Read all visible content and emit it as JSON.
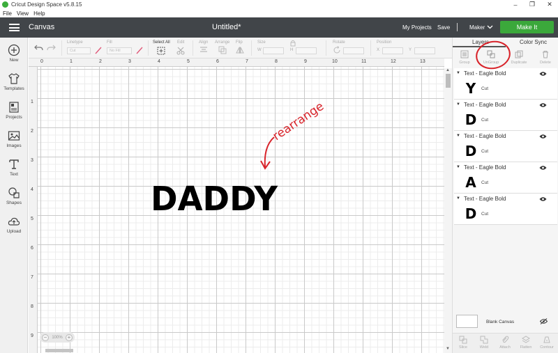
{
  "app": {
    "window_title": "Cricut Design Space  v5.8.15",
    "menu": [
      "File",
      "View",
      "Help"
    ]
  },
  "header": {
    "section": "Canvas",
    "doc_title": "Untitled*",
    "my_projects": "My Projects",
    "save": "Save",
    "separator": "|",
    "machine": "Maker",
    "make_it": "Make It"
  },
  "sidebar": {
    "items": [
      {
        "label": "New",
        "icon": "plus-circle-icon"
      },
      {
        "label": "Templates",
        "icon": "tshirt-icon"
      },
      {
        "label": "Projects",
        "icon": "projects-icon"
      },
      {
        "label": "Images",
        "icon": "image-icon"
      },
      {
        "label": "Text",
        "icon": "text-t-icon"
      },
      {
        "label": "Shapes",
        "icon": "shapes-icon"
      },
      {
        "label": "Upload",
        "icon": "cloud-upload-icon"
      }
    ]
  },
  "toolbar": {
    "linetype_label": "Linetype",
    "linetype_value": "Cut",
    "fill_label": "Fill",
    "fill_value": "No Fill",
    "select_all": "Select All",
    "edit": "Edit",
    "align": "Align",
    "arrange": "Arrange",
    "flip": "Flip",
    "size": "Size",
    "size_w": "W",
    "size_h": "H",
    "rotate": "Rotate",
    "position": "Position",
    "pos_x": "X",
    "pos_y": "Y"
  },
  "canvas": {
    "ruler_top": [
      "0",
      "1",
      "2",
      "3",
      "4",
      "5",
      "6",
      "7",
      "8",
      "9",
      "10",
      "11",
      "12",
      "13"
    ],
    "ruler_left": [
      "1",
      "2",
      "3",
      "4",
      "5",
      "6",
      "7",
      "8",
      "9"
    ],
    "design_text": "DADDY",
    "annotation": "rearrange",
    "zoom": "100%",
    "zoom_minus": "−",
    "zoom_plus": "+"
  },
  "panel": {
    "tabs": [
      "Layers",
      "Color Sync"
    ],
    "tools": [
      "Group",
      "UnGroup",
      "Duplicate",
      "Delete"
    ],
    "layers": [
      {
        "name": "Text - Eagle Bold",
        "glyph": "Y",
        "operation": "Cut"
      },
      {
        "name": "Text - Eagle Bold",
        "glyph": "D",
        "operation": "Cut"
      },
      {
        "name": "Text - Eagle Bold",
        "glyph": "D",
        "operation": "Cut"
      },
      {
        "name": "Text - Eagle Bold",
        "glyph": "A",
        "operation": "Cut"
      },
      {
        "name": "Text - Eagle Bold",
        "glyph": "D",
        "operation": "Cut"
      }
    ],
    "blank_canvas": "Blank Canvas",
    "bottom_tools": [
      "Slice",
      "Weld",
      "Attach",
      "Flatten",
      "Contour"
    ]
  },
  "colors": {
    "header_bg": "#414549",
    "make_it": "#3ba83b",
    "annotation_red": "#d8232a"
  }
}
